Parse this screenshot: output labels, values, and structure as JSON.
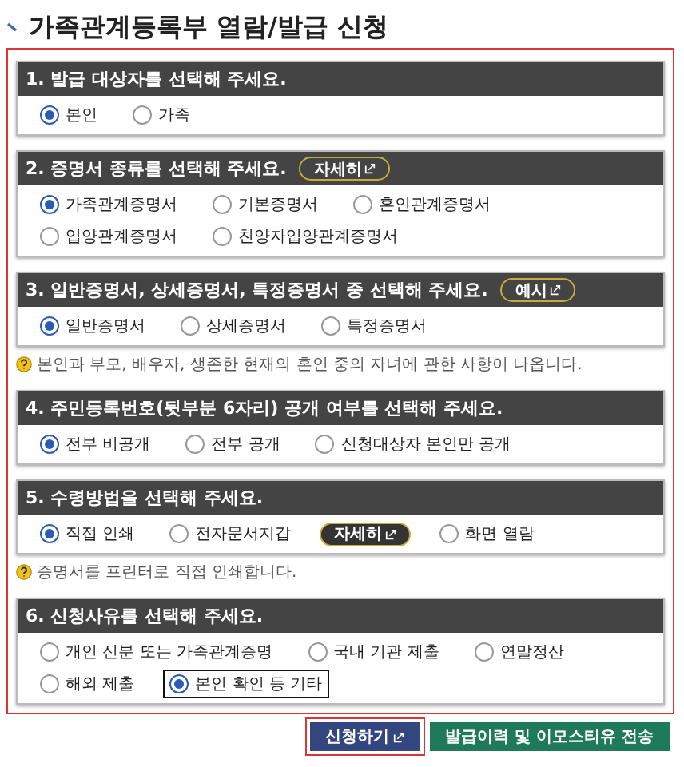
{
  "title": "가족관계등록부 열람/발급 신청",
  "sections": [
    {
      "heading": "1. 발급 대상자를 선택해 주세요.",
      "options": [
        {
          "kind": "radio",
          "label": "본인",
          "selected": true,
          "focused": false
        },
        {
          "kind": "radio",
          "label": "가족",
          "selected": false,
          "focused": false
        }
      ]
    },
    {
      "heading": "2. 증명서 종류를 선택해 주세요.",
      "button": "자세히",
      "options": [
        {
          "kind": "radio",
          "label": "가족관계증명서",
          "selected": true,
          "focused": false
        },
        {
          "kind": "radio",
          "label": "기본증명서",
          "selected": false,
          "focused": false
        },
        {
          "kind": "radio",
          "label": "혼인관계증명서",
          "selected": false,
          "focused": false
        },
        {
          "kind": "radio",
          "label": "입양관계증명서",
          "selected": false,
          "focused": false
        },
        {
          "kind": "radio",
          "label": "친양자입양관계증명서",
          "selected": false,
          "focused": false
        }
      ]
    },
    {
      "heading": "3. 일반증명서, 상세증명서, 특정증명서 중 선택해 주세요.",
      "button": "예시",
      "options": [
        {
          "kind": "radio",
          "label": "일반증명서",
          "selected": true,
          "focused": false
        },
        {
          "kind": "radio",
          "label": "상세증명서",
          "selected": false,
          "focused": false
        },
        {
          "kind": "radio",
          "label": "특정증명서",
          "selected": false,
          "focused": false
        }
      ],
      "note": "본인과 부모, 배우자, 생존한 현재의 혼인 중의 자녀에 관한 사항이 나옵니다."
    },
    {
      "heading": "4. 주민등록번호(뒷부분 6자리) 공개 여부를 선택해 주세요.",
      "options": [
        {
          "kind": "radio",
          "label": "전부 비공개",
          "selected": true,
          "focused": false
        },
        {
          "kind": "radio",
          "label": "전부 공개",
          "selected": false,
          "focused": false
        },
        {
          "kind": "radio",
          "label": "신청대상자 본인만 공개",
          "selected": false,
          "focused": false
        }
      ]
    },
    {
      "heading": "5. 수령방법을 선택해 주세요.",
      "options": [
        {
          "kind": "radio",
          "label": "직접 인쇄",
          "selected": true,
          "focused": false
        },
        {
          "kind": "radio",
          "label": "전자문서지갑",
          "selected": false,
          "focused": false
        },
        {
          "kind": "button",
          "label": "자세히"
        },
        {
          "kind": "radio",
          "label": "화면 열람",
          "selected": false,
          "focused": false
        }
      ],
      "note": "증명서를 프린터로 직접 인쇄합니다."
    },
    {
      "heading": "6. 신청사유를 선택해 주세요.",
      "options": [
        {
          "kind": "radio",
          "label": "개인 신분 또는 가족관계증명",
          "selected": false,
          "focused": false
        },
        {
          "kind": "radio",
          "label": "국내 기관 제출",
          "selected": false,
          "focused": false
        },
        {
          "kind": "radio",
          "label": "연말정산",
          "selected": false,
          "focused": false
        },
        {
          "kind": "radio",
          "label": "해외 제출",
          "selected": false,
          "focused": false
        },
        {
          "kind": "radio",
          "label": "본인 확인 등 기타",
          "selected": true,
          "focused": true
        }
      ]
    }
  ],
  "actions": [
    {
      "kind": "primary",
      "label": "신청하기",
      "focused": true
    },
    {
      "kind": "secondary",
      "label": "발급이력 및 이모스티유 전송",
      "focused": false
    }
  ]
}
